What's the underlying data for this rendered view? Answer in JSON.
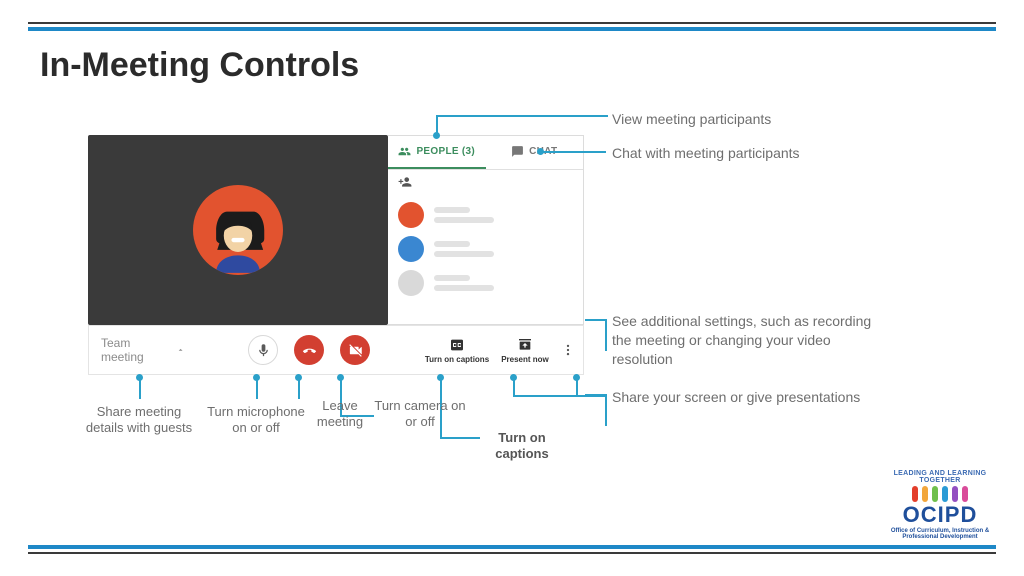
{
  "title": "In-Meeting Controls",
  "meeting": {
    "name": "Team meeting",
    "tabs": {
      "people": "PEOPLE (3)",
      "chat": "CHAT"
    },
    "buttons": {
      "captions": "Turn on captions",
      "present": "Present now"
    }
  },
  "callouts": {
    "right": {
      "view_participants": "View meeting participants",
      "chat_participants": "Chat with meeting participants",
      "more_settings": "See additional settings, such as recording the meeting or changing your video resolution",
      "share_screen": "Share your screen or give presentations"
    },
    "bottom": {
      "share_details": "Share meeting details with guests",
      "mic": "Turn microphone on or off",
      "leave": "Leave meeting",
      "camera": "Turn camera on or off",
      "captions": "Turn on captions"
    }
  },
  "logo": {
    "arc": "LEADING AND LEARNING TOGETHER",
    "name": "OCIPD",
    "sub": "Office of Curriculum, Instruction & Professional Development",
    "colors": [
      "#e33e2b",
      "#f2a63b",
      "#6fbf4b",
      "#2a9bd6",
      "#934fc1",
      "#d94b9a"
    ]
  }
}
